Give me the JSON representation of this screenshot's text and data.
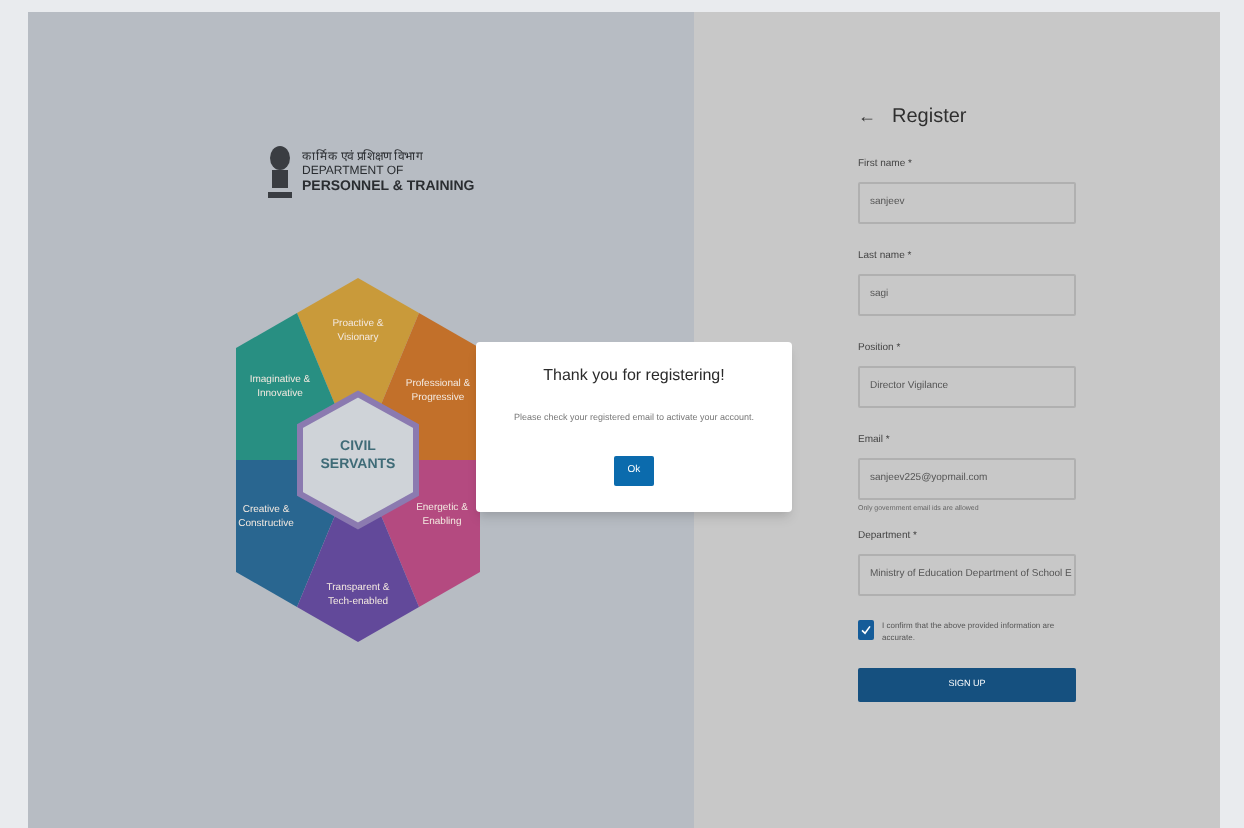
{
  "logo": {
    "hindi": "कार्मिक एवं प्रशिक्षण विभाग",
    "line_1": "DEPARTMENT OF",
    "line_2": "PERSONNEL & TRAINING"
  },
  "emblem": {
    "center": "CIVIL SERVANTS",
    "segments": [
      {
        "label": "Proactive & Visionary",
        "color": "#c99a3a"
      },
      {
        "label": "Imaginative & Innovative",
        "color": "#288f82"
      },
      {
        "label": "Professional & Progressive",
        "color": "#c2702a"
      },
      {
        "label": "Creative & Constructive",
        "color": "#296690"
      },
      {
        "label": "Energetic & Enabling",
        "color": "#b44a80"
      },
      {
        "label": "Transparent & Tech-enabled",
        "color": "#62499a"
      }
    ]
  },
  "dialog": {
    "title": "Thank you for registering!",
    "message": "Please check your registered email to activate your account.",
    "button": "Ok"
  },
  "form": {
    "back": "←",
    "title": "Register",
    "fields": [
      {
        "label": "First name",
        "required": "*",
        "value": "sanjeev"
      },
      {
        "label": "Last name",
        "required": "*",
        "value": "sagi"
      },
      {
        "label": "Position",
        "required": "*",
        "value": "Director Vigilance"
      },
      {
        "label": "Email",
        "required": "*",
        "value": "sanjeev225@yopmail.com",
        "hint": "Only government email ids are allowed"
      },
      {
        "label": "Department",
        "required": "*",
        "value": "Ministry of Education Department of School E"
      }
    ],
    "confirm": {
      "text": "I confirm that the above provided information are accurate.",
      "checked": true
    },
    "submit": "SIGN UP"
  }
}
